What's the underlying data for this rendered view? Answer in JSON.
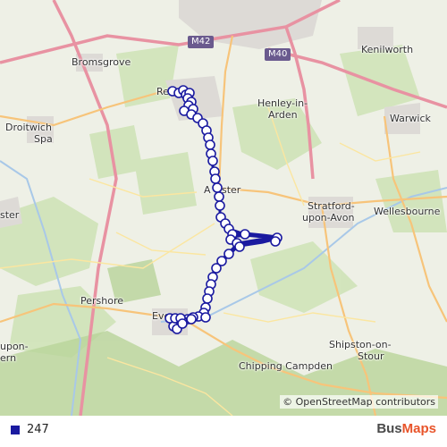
{
  "map": {
    "places": [
      "Bromsgrove",
      "Red",
      "Droitwich",
      "Spa",
      "ster",
      "Henley-in-",
      "Arden",
      "Kenilworth",
      "Warwick",
      "A",
      "ster",
      "Stratford-",
      "upon-Avon",
      "Wellesbourne",
      "Pershore",
      "Eve",
      "Chipping Campden",
      "Shipston-on-",
      "Stour",
      "upon-",
      "ern"
    ],
    "road_labels": [
      "M42",
      "M40"
    ],
    "attribution": "© OpenStreetMap contributors"
  },
  "legend": {
    "route_label": "247",
    "route_color": "#1a1aa0"
  },
  "brand": {
    "part1": "Bus",
    "part2": "Maps"
  }
}
